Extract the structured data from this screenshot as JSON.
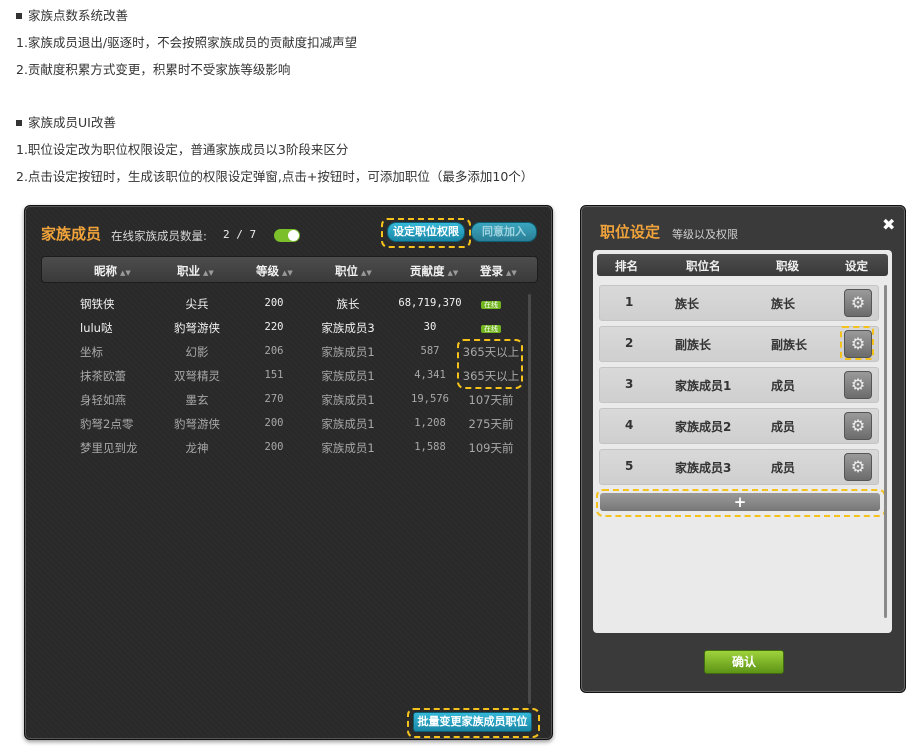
{
  "notes": {
    "section1_heading": "家族点数系统改善",
    "section1_line1": "1.家族成员退出/驱逐时，不会按照家族成员的贡献度扣减声望",
    "section1_line2": "2.贡献度积累方式变更，积累时不受家族等级影响",
    "section2_heading": "家族成员UI改善",
    "section2_line1": "1.职位设定改为职位权限设定，普通家族成员以3阶段来区分",
    "section2_line2": "2.点击设定按钮时，生成该职位的权限设定弹窗,点击+按钮时，可添加职位（最多添加10个）"
  },
  "family_panel": {
    "title": "家族成员",
    "online_label": "在线家族成员数量:",
    "online_count": "2 / 7",
    "set_permission_button": "设定职位权限",
    "approve_join_button": "同意加入",
    "batch_change_button": "批量变更家族成员职位",
    "columns": [
      "昵称",
      "职业",
      "等级",
      "职位",
      "贡献度",
      "登录"
    ],
    "members": [
      {
        "name": "钢铁侠",
        "job": "尖兵",
        "level": "200",
        "position": "族长",
        "contribution": "68,719,370",
        "login": "在线",
        "online": true
      },
      {
        "name": "lulu哒",
        "job": "豹弩游侠",
        "level": "220",
        "position": "家族成员3",
        "contribution": "30",
        "login": "在线",
        "online": true
      },
      {
        "name": "坐标",
        "job": "幻影",
        "level": "206",
        "position": "家族成员1",
        "contribution": "587",
        "login": "365天以上",
        "online": false
      },
      {
        "name": "抹茶欧蕾",
        "job": "双弩精灵",
        "level": "151",
        "position": "家族成员1",
        "contribution": "4,341",
        "login": "365天以上",
        "online": false
      },
      {
        "name": "身轻如燕",
        "job": "墨玄",
        "level": "270",
        "position": "家族成员1",
        "contribution": "19,576",
        "login": "107天前",
        "online": false
      },
      {
        "name": "豹弩2点零",
        "job": "豹弩游侠",
        "level": "200",
        "position": "家族成员1",
        "contribution": "1,208",
        "login": "275天前",
        "online": false
      },
      {
        "name": "梦里见到龙",
        "job": "龙神",
        "level": "200",
        "position": "家族成员1",
        "contribution": "1,588",
        "login": "109天前",
        "online": false
      }
    ]
  },
  "role_panel": {
    "title": "职位设定",
    "subtitle": "等级以及权限",
    "close_glyph": "✖",
    "columns": [
      "排名",
      "职位名",
      "职级",
      "设定"
    ],
    "roles": [
      {
        "rank": "1",
        "name": "族长",
        "grade": "族长"
      },
      {
        "rank": "2",
        "name": "副族长",
        "grade": "副族长"
      },
      {
        "rank": "3",
        "name": "家族成员1",
        "grade": "成员"
      },
      {
        "rank": "4",
        "name": "家族成员2",
        "grade": "成员"
      },
      {
        "rank": "5",
        "name": "家族成员3",
        "grade": "成员"
      }
    ],
    "add_glyph": "+",
    "confirm_button": "确认"
  },
  "icons": {
    "gear": "gear-icon",
    "close": "close-icon",
    "sort": "sort-arrows-icon"
  },
  "colors": {
    "highlight": "#f5c21c",
    "title_orange": "#f0a33a",
    "online_green": "#72b51f",
    "button_blue": "#1a86a6"
  }
}
